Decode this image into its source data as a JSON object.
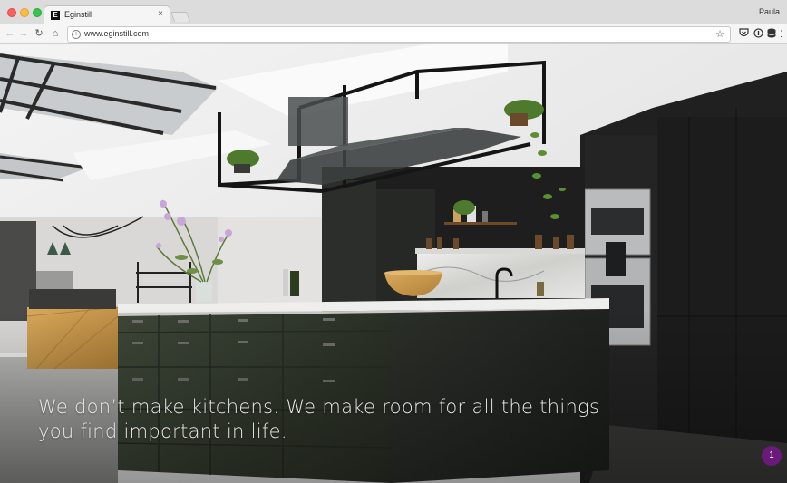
{
  "browser": {
    "tab_title": "Eginstill",
    "tab_close": "×",
    "favicon_letter": "E",
    "profile_name": "Paula",
    "url": "www.eginstill.com",
    "icons": [
      "back-arrow-icon",
      "forward-arrow-icon",
      "reload-icon",
      "home-icon",
      "info-icon",
      "bookmark-star-icon",
      "pocket-icon",
      "extension-icon",
      "database-icon",
      "menu-icon"
    ]
  },
  "hero": {
    "tagline_line1": "We don’t make kitchens. We make room for all the things",
    "tagline_line2": "you find important in life.",
    "image_subject": "kitchen-interior"
  },
  "notification": {
    "count": "1",
    "color": "#6a1a78"
  }
}
